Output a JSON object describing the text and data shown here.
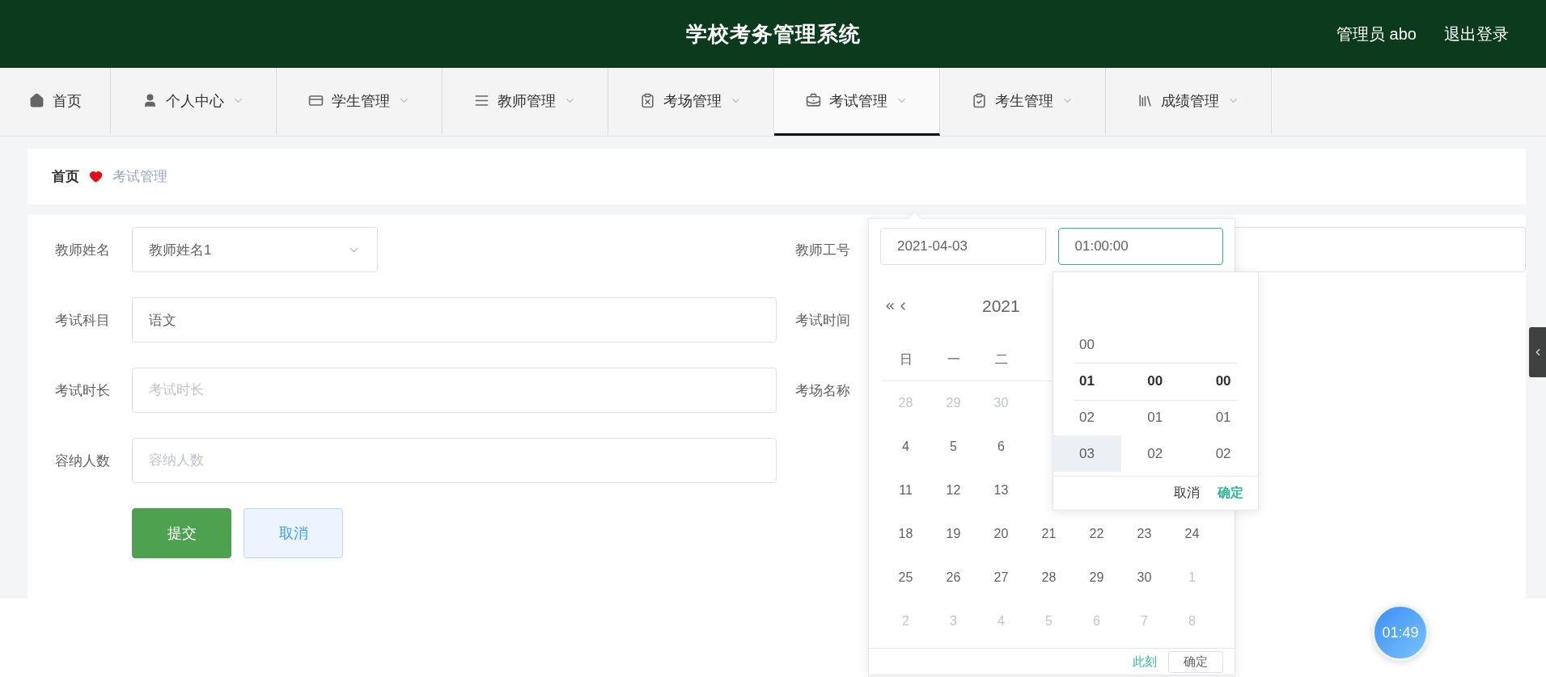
{
  "header": {
    "title": "学校考务管理系统",
    "user": "管理员 abo",
    "logout": "退出登录"
  },
  "nav": [
    {
      "label": "首页",
      "selected": false
    },
    {
      "label": "个人中心",
      "selected": false
    },
    {
      "label": "学生管理",
      "selected": false
    },
    {
      "label": "教师管理",
      "selected": false
    },
    {
      "label": "考场管理",
      "selected": false
    },
    {
      "label": "考试管理",
      "selected": true
    },
    {
      "label": "考生管理",
      "selected": false
    },
    {
      "label": "成绩管理",
      "selected": false
    }
  ],
  "breadcrumb": {
    "home": "首页",
    "current": "考试管理"
  },
  "form": {
    "left_fields": [
      {
        "label": "教师姓名",
        "kind": "select",
        "value": "教师姓名1"
      },
      {
        "label": "考试科目",
        "kind": "input",
        "value": "语文"
      },
      {
        "label": "考试时长",
        "kind": "input",
        "placeholder": "考试时长"
      },
      {
        "label": "容纳人数",
        "kind": "input",
        "placeholder": "容纳人数"
      }
    ],
    "right_fields": [
      {
        "label": "教师工号",
        "kind": "input"
      },
      {
        "label": "考试时间",
        "kind": "label"
      },
      {
        "label": "考场名称",
        "kind": "label"
      }
    ],
    "buttons": [
      {
        "label": "提交",
        "kind": "primary"
      },
      {
        "label": "取消",
        "kind": "plain"
      }
    ]
  },
  "picker": {
    "date": "2021-04-03",
    "time": "01:00:00",
    "year": "2021",
    "weekdays": [
      "日",
      "一",
      "二"
    ],
    "weeks": [
      [
        {
          "day": "28",
          "muted": true
        },
        {
          "day": "29",
          "muted": true
        },
        {
          "day": "30",
          "muted": true
        }
      ],
      [
        {
          "day": "4",
          "muted": false
        },
        {
          "day": "5",
          "muted": false
        },
        {
          "day": "6",
          "muted": false
        }
      ],
      [
        {
          "day": "11",
          "muted": false
        },
        {
          "day": "12",
          "muted": false
        },
        {
          "day": "13",
          "muted": false
        }
      ],
      [
        {
          "day": "18",
          "muted": false
        },
        {
          "day": "19",
          "muted": false
        },
        {
          "day": "20",
          "muted": false
        },
        {
          "day": "21",
          "muted": false
        },
        {
          "day": "22",
          "muted": false
        },
        {
          "day": "23",
          "muted": false
        },
        {
          "day": "24",
          "muted": false
        }
      ],
      [
        {
          "day": "25",
          "muted": false
        },
        {
          "day": "26",
          "muted": false
        },
        {
          "day": "27",
          "muted": false
        },
        {
          "day": "28",
          "muted": false
        },
        {
          "day": "29",
          "muted": false
        },
        {
          "day": "30",
          "muted": false
        },
        {
          "day": "1",
          "muted": true
        }
      ],
      [
        {
          "day": "2",
          "muted": true
        },
        {
          "day": "3",
          "muted": true
        },
        {
          "day": "4",
          "muted": true
        },
        {
          "day": "5",
          "muted": true
        },
        {
          "day": "6",
          "muted": true
        },
        {
          "day": "7",
          "muted": true
        },
        {
          "day": "8",
          "muted": true
        }
      ]
    ],
    "time_columns": [
      [
        {
          "value": "00",
          "selected": false,
          "hovered": false
        },
        {
          "value": "01",
          "selected": true,
          "hovered": false
        },
        {
          "value": "02",
          "selected": false,
          "hovered": false
        },
        {
          "value": "03",
          "selected": false,
          "hovered": true
        }
      ],
      [
        {
          "value": "00",
          "selected": true,
          "hovered": false
        },
        {
          "value": "01",
          "selected": false,
          "hovered": false
        },
        {
          "value": "02",
          "selected": false,
          "hovered": false
        }
      ],
      [
        {
          "value": "00",
          "selected": true,
          "hovered": false
        },
        {
          "value": "01",
          "selected": false,
          "hovered": false
        },
        {
          "value": "02",
          "selected": false,
          "hovered": false
        }
      ]
    ],
    "time_cancel": "取消",
    "time_confirm": "确定",
    "now": "此刻",
    "confirm": "确定"
  },
  "timer": "01:49"
}
